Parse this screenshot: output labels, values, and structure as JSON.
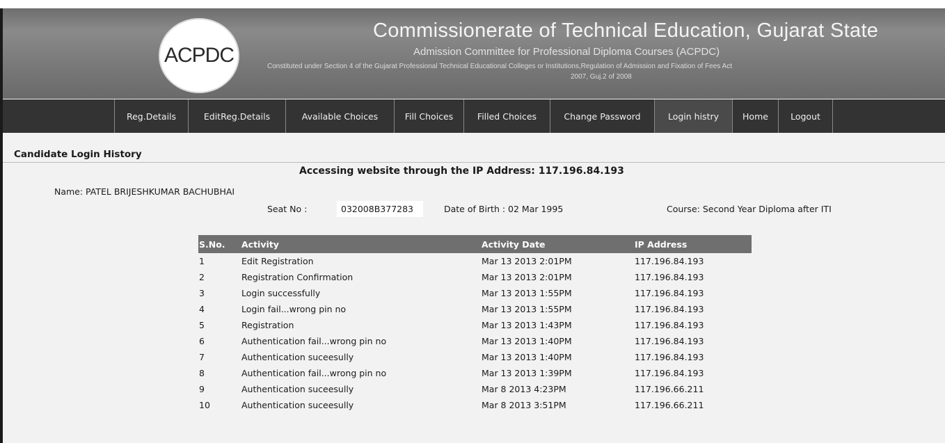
{
  "header": {
    "logo_text": "ACPDC",
    "title": "Commissionerate of Technical Education, Gujarat State",
    "subtitle": "Admission Committee for Professional Diploma Courses (ACPDC)",
    "small_text_line1": "Constituted under Section 4 of the Gujarat Professional Technical Educational Colleges or Institutions,Regulation of Admission and Fixation of Fees Act",
    "small_text_line2": "2007, Guj.2 of 2008"
  },
  "nav": {
    "items": [
      {
        "label": "Reg.Details"
      },
      {
        "label": "EditReg.Details"
      },
      {
        "label": "Available Choices"
      },
      {
        "label": "Fill Choices"
      },
      {
        "label": "Filled Choices"
      },
      {
        "label": "Change Password"
      },
      {
        "label": "Login histry"
      },
      {
        "label": "Home"
      },
      {
        "label": "Logout"
      }
    ]
  },
  "page": {
    "section_title": "Candidate Login History",
    "ip_line": "Accessing website through the IP Address: 117.196.84.193",
    "name": "Name: PATEL BRIJESHKUMAR BACHUBHAI",
    "seat_label": "Seat No :",
    "seat_value": "032008B377283",
    "dob": "Date of Birth : 02 Mar 1995",
    "course": "Course: Second Year Diploma after ITI"
  },
  "table": {
    "headers": [
      "S.No.",
      "Activity",
      "Activity Date",
      "IP Address"
    ],
    "rows": [
      [
        "1",
        "Edit Registration",
        "Mar 13 2013 2:01PM",
        "117.196.84.193"
      ],
      [
        "2",
        "Registration Confirmation",
        "Mar 13 2013 2:01PM",
        "117.196.84.193"
      ],
      [
        "3",
        "Login successfully",
        "Mar 13 2013 1:55PM",
        "117.196.84.193"
      ],
      [
        "4",
        "Login fail...wrong pin no",
        "Mar 13 2013 1:55PM",
        "117.196.84.193"
      ],
      [
        "5",
        "Registration",
        "Mar 13 2013 1:43PM",
        "117.196.84.193"
      ],
      [
        "6",
        "Authentication fail...wrong pin no",
        "Mar 13 2013 1:40PM",
        "117.196.84.193"
      ],
      [
        "7",
        "Authentication suceesully",
        "Mar 13 2013 1:40PM",
        "117.196.84.193"
      ],
      [
        "8",
        "Authentication fail...wrong pin no",
        "Mar 13 2013 1:39PM",
        "117.196.84.193"
      ],
      [
        "9",
        "Authentication suceesully",
        "Mar 8 2013 4:23PM",
        "117.196.66.211"
      ],
      [
        "10",
        "Authentication suceesully",
        "Mar 8 2013 3:51PM",
        "117.196.66.211"
      ]
    ]
  }
}
